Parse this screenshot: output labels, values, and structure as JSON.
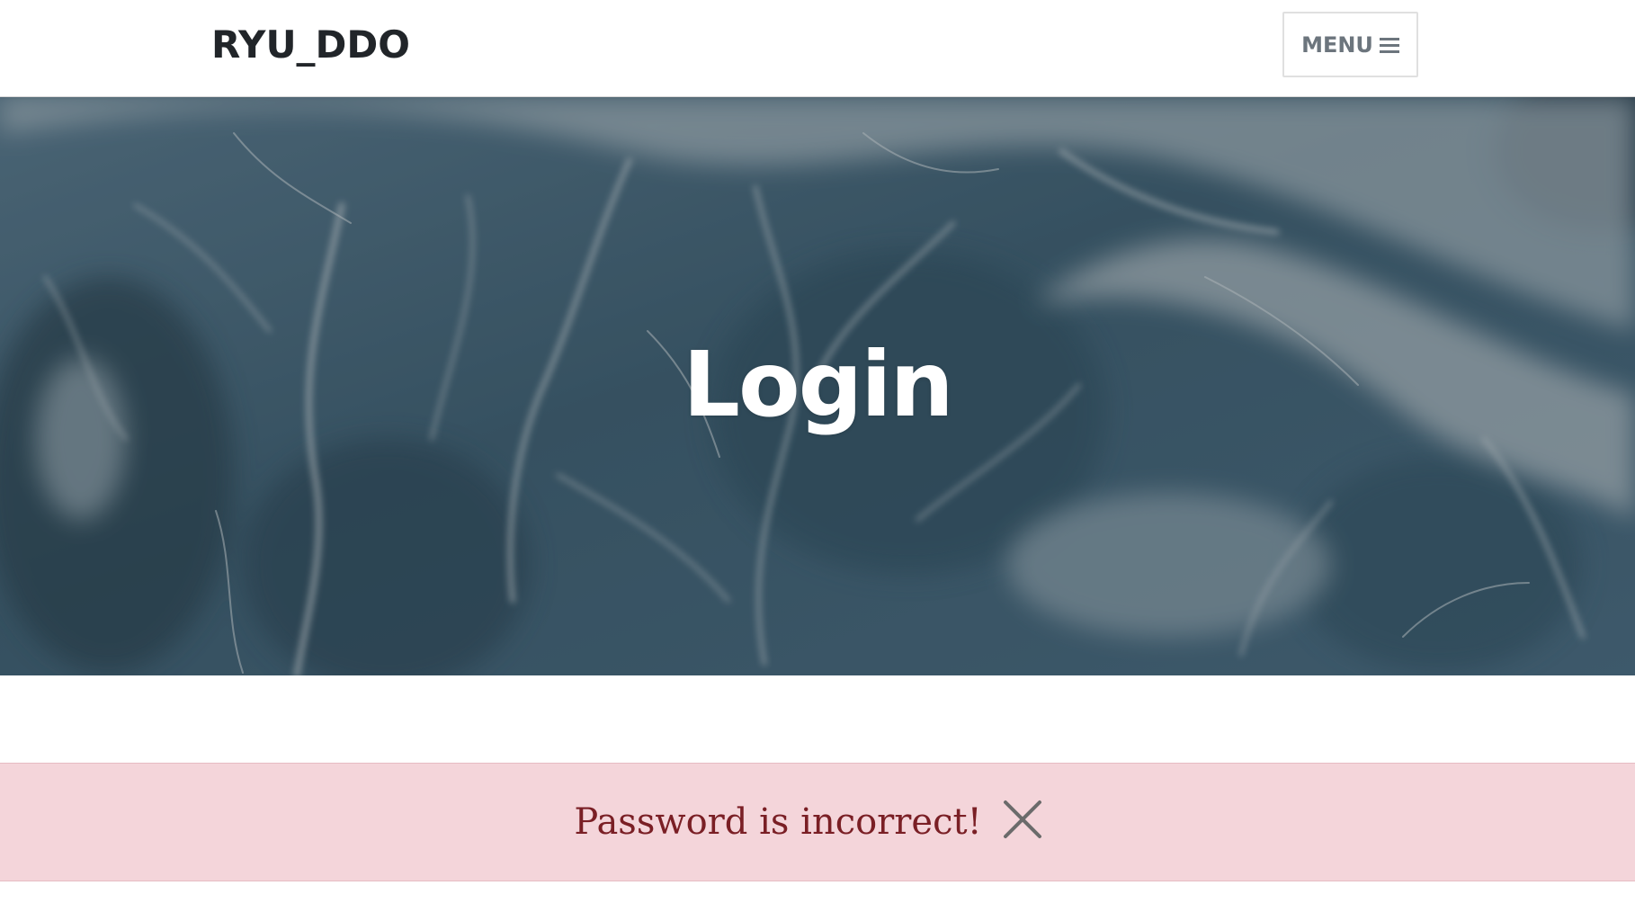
{
  "navbar": {
    "brand": "RYU_DDO",
    "menu_label": "MENU",
    "menu_icon": "hamburger-icon"
  },
  "hero": {
    "title": "Login",
    "background": "ocean-waves-image"
  },
  "alert": {
    "message": "Password is incorrect!",
    "close_icon": "close-icon",
    "background_color": "#f4d5da",
    "text_color": "#7a1f25"
  }
}
